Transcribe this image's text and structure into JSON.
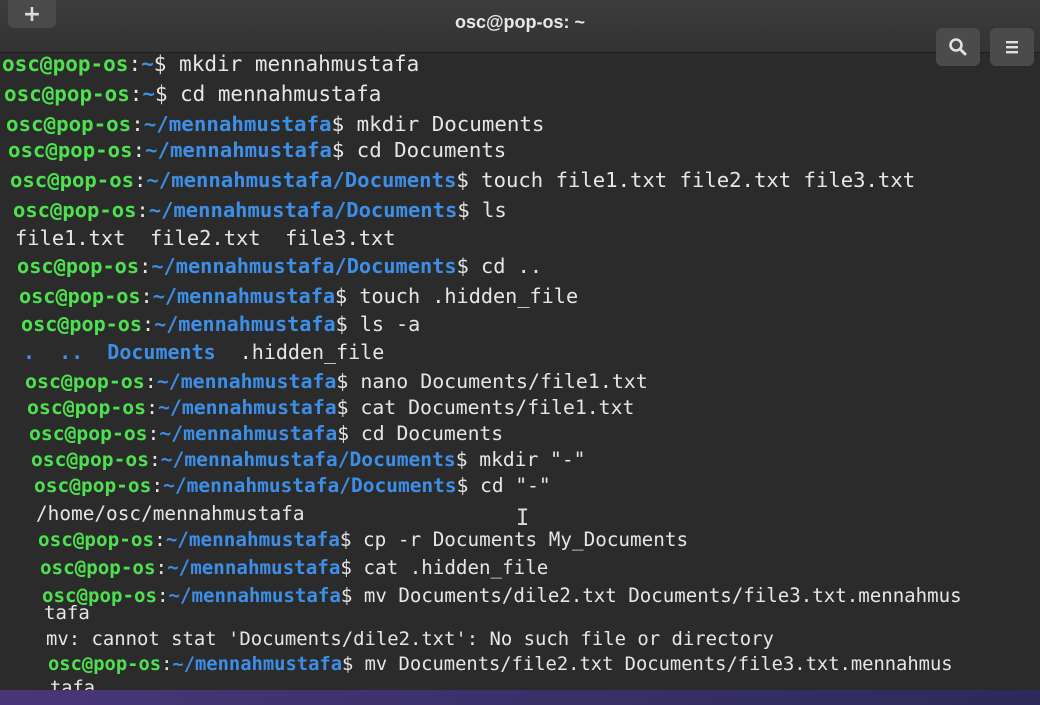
{
  "window": {
    "title": "osc@pop-os: ~",
    "new_tab_glyph": "+"
  },
  "icons": {
    "search": "search-icon",
    "menu": "hamburger-menu-icon"
  },
  "colors": {
    "user": "#4ee04e",
    "path": "#3d8ee6",
    "text": "#e6e6e6",
    "background": "#2b2b2b"
  },
  "prompt": {
    "user": "osc@pop-os",
    "sep": ":"
  },
  "lines": [
    {
      "type": "cmd",
      "path": "~",
      "cmd": " mkdir mennahmustafa"
    },
    {
      "type": "cmd",
      "path": "~",
      "cmd": " cd mennahmustafa"
    },
    {
      "type": "cmd",
      "path": "~/mennahmustafa",
      "cmd": " mkdir Documents"
    },
    {
      "type": "cmd",
      "path": "~/mennahmustafa",
      "cmd": " cd Documents"
    },
    {
      "type": "cmd",
      "path": "~/mennahmustafa/Documents",
      "cmd": " touch file1.txt file2.txt file3.txt"
    },
    {
      "type": "cmd",
      "path": "~/mennahmustafa/Documents",
      "cmd": " ls"
    },
    {
      "type": "out",
      "text": "file1.txt  file2.txt  file3.txt"
    },
    {
      "type": "cmd",
      "path": "~/mennahmustafa/Documents",
      "cmd": " cd .."
    },
    {
      "type": "cmd",
      "path": "~/mennahmustafa",
      "cmd": " touch .hidden_file"
    },
    {
      "type": "cmd",
      "path": "~/mennahmustafa",
      "cmd": " ls -a"
    },
    {
      "type": "ls",
      "dots": ".  ..",
      "dir": "Documents",
      "rest": "  .hidden_file"
    },
    {
      "type": "cmd",
      "path": "~/mennahmustafa",
      "cmd": " nano Documents/file1.txt"
    },
    {
      "type": "cmd",
      "path": "~/mennahmustafa",
      "cmd": " cat Documents/file1.txt"
    },
    {
      "type": "cmd",
      "path": "~/mennahmustafa",
      "cmd": " cd Documents"
    },
    {
      "type": "cmd",
      "path": "~/mennahmustafa/Documents",
      "cmd": " mkdir \"-\""
    },
    {
      "type": "cmd",
      "path": "~/mennahmustafa/Documents",
      "cmd": " cd \"-\""
    },
    {
      "type": "out",
      "text": "/home/osc/mennahmustafa"
    },
    {
      "type": "cmd",
      "path": "~/mennahmustafa",
      "cmd": " cp -r Documents My_Documents"
    },
    {
      "type": "cmd",
      "path": "~/mennahmustafa",
      "cmd": " cat .hidden_file"
    },
    {
      "type": "cmd",
      "path": "~/mennahmustafa",
      "cmd": " mv Documents/dile2.txt Documents/file3.txt.mennahmus"
    },
    {
      "type": "out",
      "text": "tafa"
    },
    {
      "type": "out",
      "text": "mv: cannot stat 'Documents/dile2.txt': No such file or directory"
    },
    {
      "type": "cmd",
      "path": "~/mennahmustafa",
      "cmd": " mv Documents/file2.txt Documents/file3.txt.mennahmus"
    },
    {
      "type": "out",
      "text": "tafa"
    }
  ]
}
